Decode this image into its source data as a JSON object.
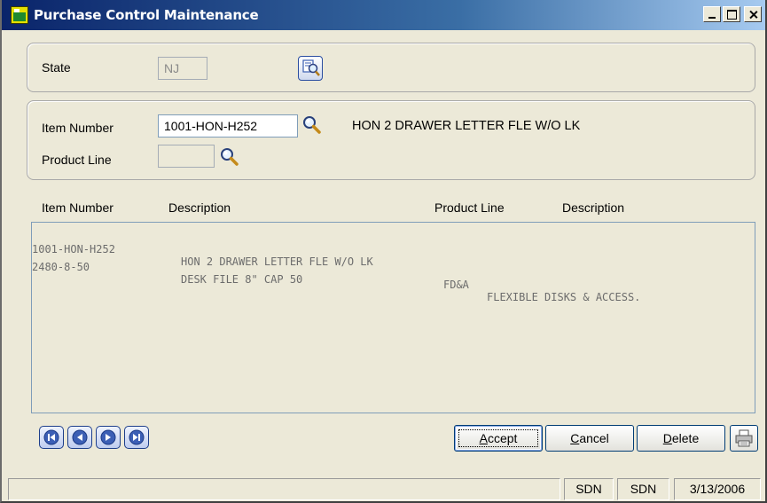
{
  "window": {
    "title": "Purchase Control Maintenance"
  },
  "state_group": {
    "state_label": "State",
    "state_value": "NJ"
  },
  "item_group": {
    "item_number_label": "Item Number",
    "item_number_value": "1001-HON-H252",
    "item_description": "HON 2 DRAWER LETTER FLE W/O LK",
    "product_line_label": "Product Line",
    "product_line_value": ""
  },
  "list": {
    "headers": {
      "item_number": "Item Number",
      "description": "Description",
      "product_line": "Product Line",
      "product_line_description": "Description"
    },
    "rows": [
      {
        "item_number": "1001-HON-H252",
        "description": "HON 2 DRAWER LETTER FLE W/O LK",
        "product_line": "",
        "product_line_description": ""
      },
      {
        "item_number": "2480-8-50",
        "description": "DESK FILE 8\" CAP 50",
        "product_line": "",
        "product_line_description": ""
      },
      {
        "item_number": "",
        "description": "",
        "product_line": "FD&A",
        "product_line_description": "FLEXIBLE DISKS & ACCESS."
      }
    ]
  },
  "buttons": {
    "accept": {
      "prefix": "",
      "underline": "A",
      "rest": "ccept"
    },
    "cancel": {
      "prefix": "",
      "underline": "C",
      "rest": "ancel"
    },
    "delete": {
      "prefix": "",
      "underline": "D",
      "rest": "elete"
    }
  },
  "statusbar": {
    "company": "SDN",
    "user": "SDN",
    "date": "3/13/2006"
  },
  "colors": {
    "title_gradient_start": "#0a246a",
    "window_background": "#ece9d8",
    "disabled_text": "#6c6c6c"
  }
}
